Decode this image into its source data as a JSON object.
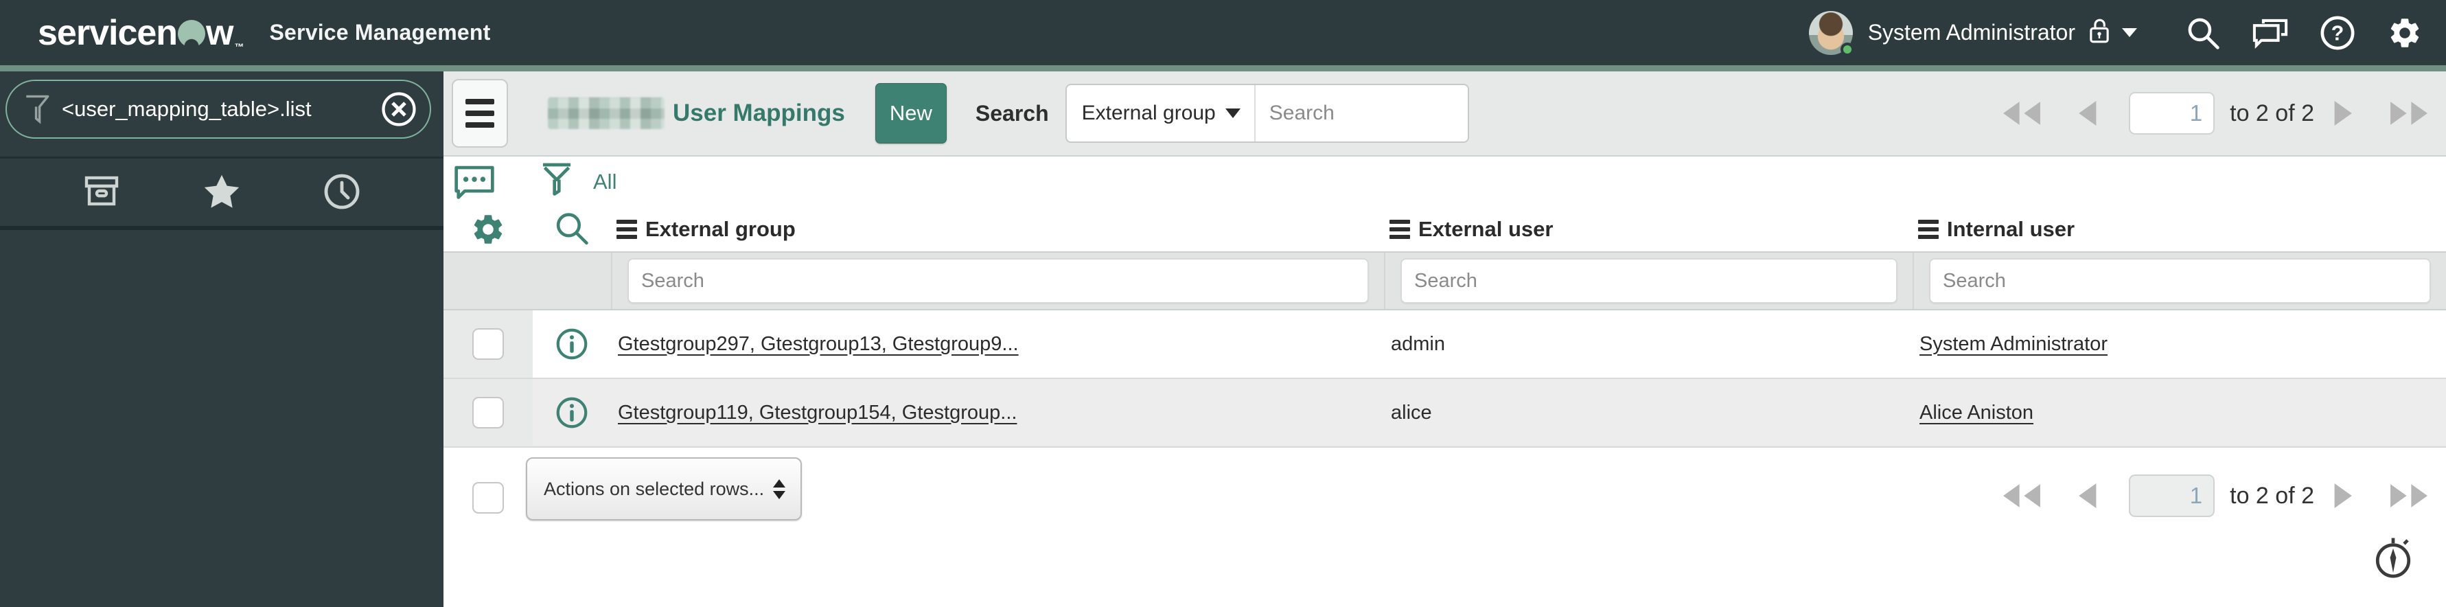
{
  "header": {
    "logo": {
      "part1": "servicen",
      "part2": "w",
      "tm": "™"
    },
    "product": "Service Management",
    "user_name": "System Administrator"
  },
  "sidebar": {
    "filter_value": "<user_mapping_table>.list"
  },
  "toolbar": {
    "title": "User Mappings",
    "new_label": "New",
    "search_label": "Search",
    "search_column": "External group",
    "search_placeholder": "Search",
    "pagination": {
      "page": "1",
      "range_label": "to 2 of 2"
    }
  },
  "list": {
    "all_label": "All",
    "column_search_placeholder": "Search",
    "columns": [
      {
        "label": "External group"
      },
      {
        "label": "External user"
      },
      {
        "label": "Internal user"
      }
    ],
    "rows": [
      {
        "external_group": "Gtestgroup297, Gtestgroup13, Gtestgroup9...",
        "external_user": "admin",
        "internal_user": "System Administrator"
      },
      {
        "external_group": "Gtestgroup119, Gtestgroup154, Gtestgroup...",
        "external_user": "alice",
        "internal_user": "Alice Aniston"
      }
    ],
    "actions_label": "Actions on selected rows...",
    "pagination": {
      "page": "1",
      "range_label": "to 2 of 2"
    }
  },
  "colors": {
    "accent": "#3E8273",
    "banner": "#2D3B3E",
    "strip": "#6F9082",
    "sage_logo": "#9FC2B0"
  }
}
